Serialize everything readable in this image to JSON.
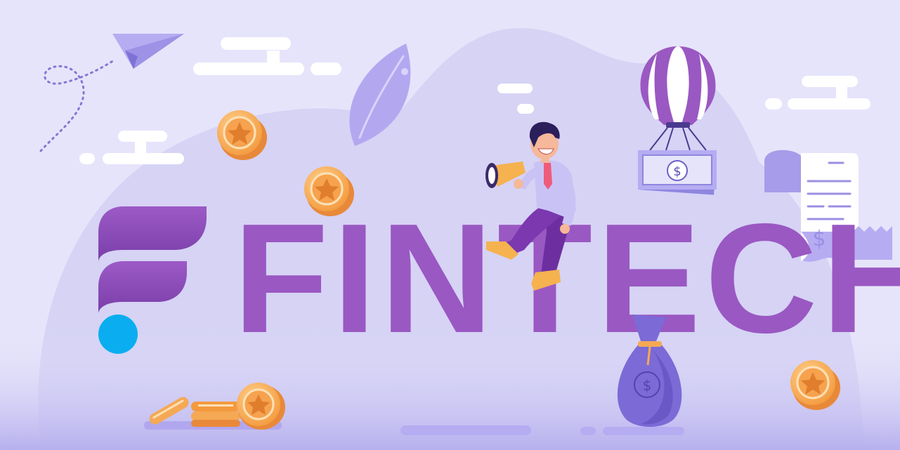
{
  "title": "FINTECH",
  "currency_symbol": "$",
  "colors": {
    "background": "#e6e4fa",
    "blob": "#d4d1f4",
    "title_purple": "#9a58c2",
    "logo_top": "#9b58c4",
    "logo_bottom": "#7d3fab",
    "logo_dot": "#0aaef0",
    "coin": "#f5a955",
    "coin_light": "#fdd39b",
    "lavender": "#b6acf2",
    "bag": "#7c6ad6"
  },
  "icons": [
    "logo-f-icon",
    "paper-plane-icon",
    "leaf-icon",
    "coin-icon",
    "hot-air-balloon-icon",
    "banknote-icon",
    "receipt-icon",
    "money-bag-icon",
    "megaphone-icon",
    "person-illustration"
  ]
}
